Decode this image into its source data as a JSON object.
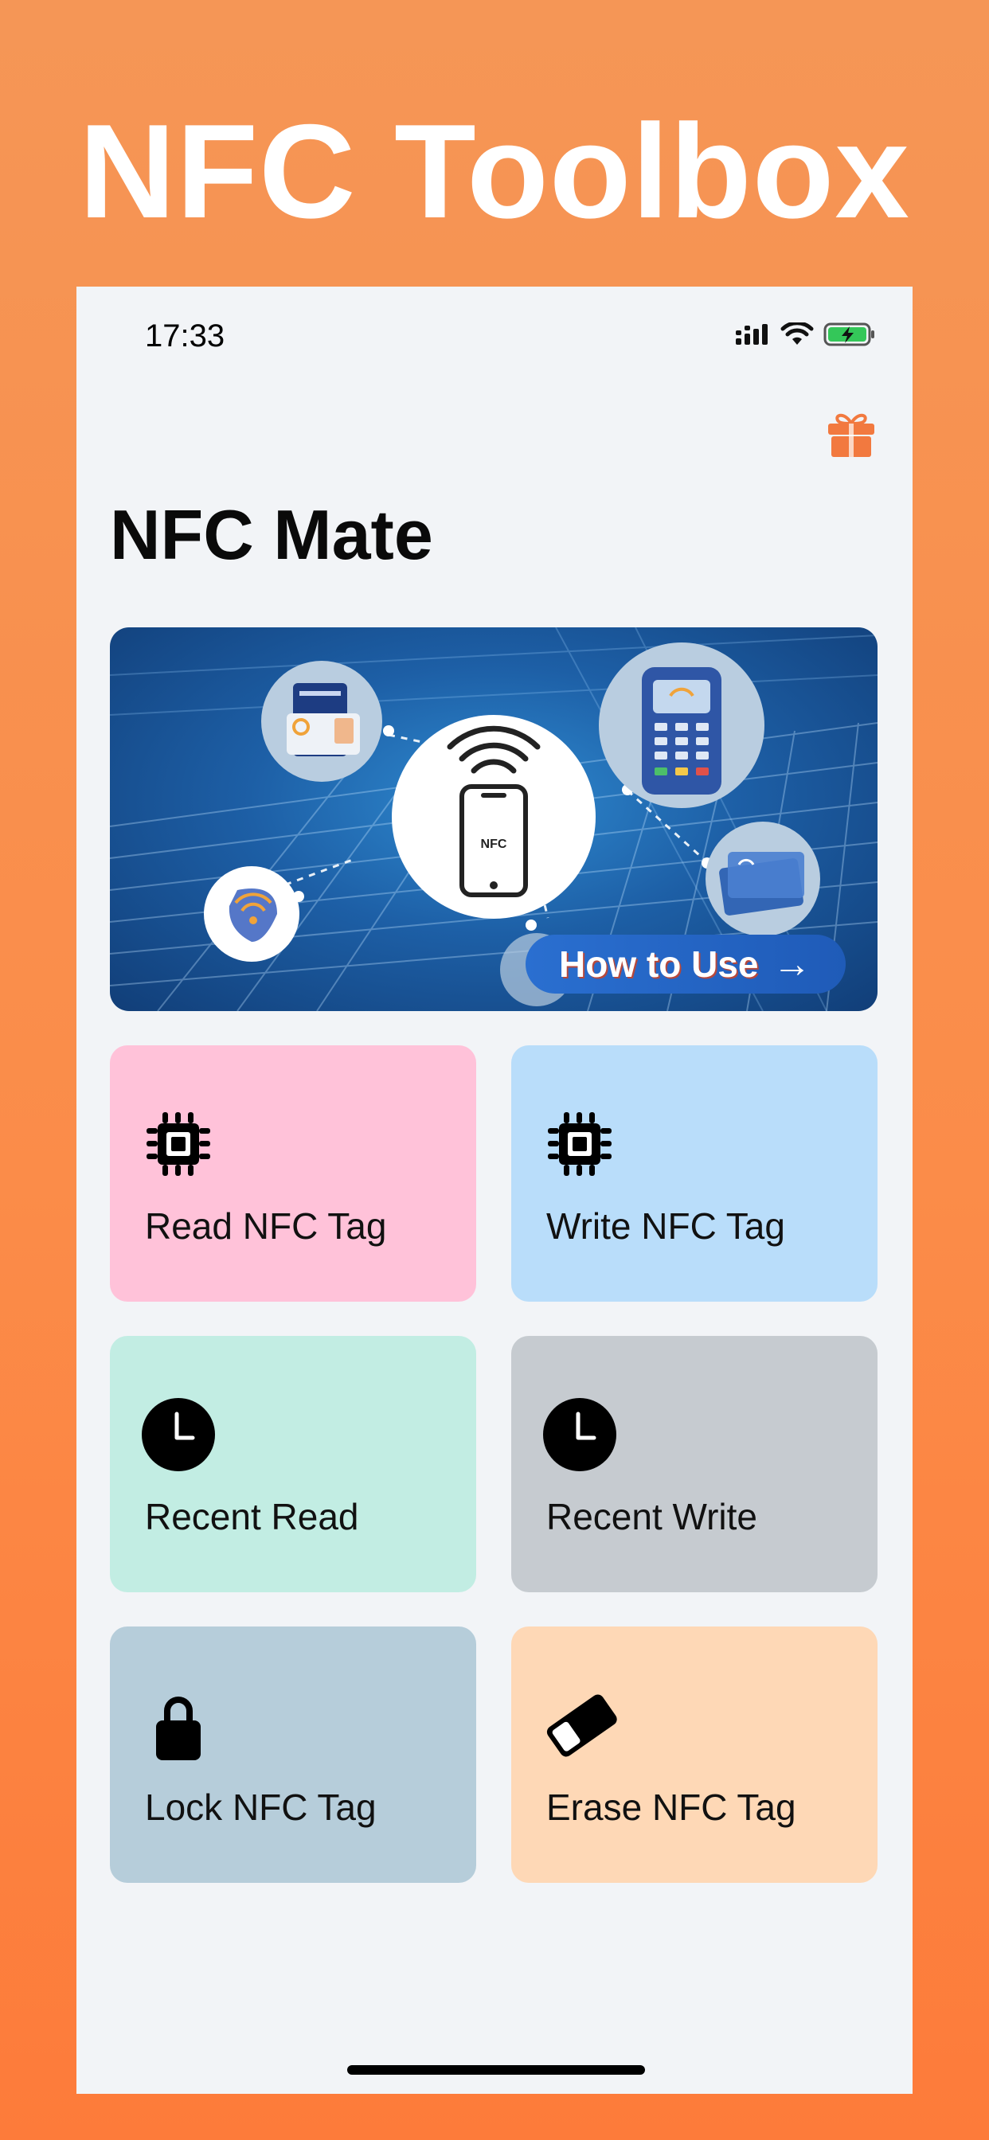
{
  "promo": {
    "title": "NFC Toolbox"
  },
  "status_bar": {
    "time": "17:33",
    "icons": [
      "signal-icon",
      "wifi-icon",
      "battery-charging-icon"
    ]
  },
  "header": {
    "title": "NFC Mate",
    "gift_icon": "gift-icon"
  },
  "banner": {
    "button_label": "How to Use",
    "button_arrow": "→",
    "phone_label": "NFC"
  },
  "tiles": [
    {
      "label": "Read NFC Tag",
      "icon": "chip-icon",
      "color": "#ffc2d9"
    },
    {
      "label": "Write NFC Tag",
      "icon": "chip-icon",
      "color": "#b9ddfa"
    },
    {
      "label": "Recent Read",
      "icon": "clock-icon",
      "color": "#c2ede3"
    },
    {
      "label": "Recent Write",
      "icon": "clock-icon",
      "color": "#c6cbd0"
    },
    {
      "label": "Lock NFC Tag",
      "icon": "lock-icon",
      "color": "#b6cdda"
    },
    {
      "label": "Erase NFC Tag",
      "icon": "eraser-icon",
      "color": "#fed8b6"
    }
  ],
  "colors": {
    "background": "#fb8c49",
    "accent_orange": "#f2793f",
    "screen_background": "#f2f4f7"
  }
}
